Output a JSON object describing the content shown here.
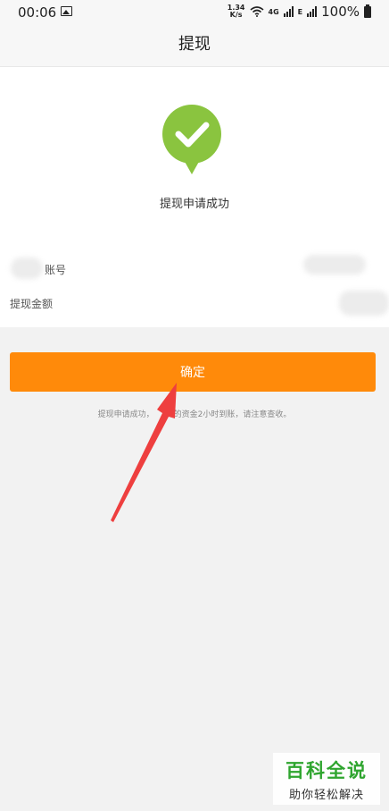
{
  "status_bar": {
    "time": "00:06",
    "net_speed_value": "1.34",
    "net_speed_unit": "K/s",
    "network_4g": "4G",
    "network_e": "E",
    "battery": "100%"
  },
  "nav": {
    "title": "提现"
  },
  "result": {
    "message": "提现申请成功"
  },
  "details": {
    "account_label": "账号",
    "amount_label": "提现金额"
  },
  "actions": {
    "confirm_label": "确定"
  },
  "tip": {
    "text_before": "提现申请成功，",
    "text_after": "的资金2小时到账，请注意查收。"
  },
  "watermark": {
    "title": "百科全说",
    "subtitle": "助你轻松解决"
  },
  "colors": {
    "accent": "#ff8a0a",
    "success": "#8ac43f",
    "annotation": "#ee3f3f"
  }
}
